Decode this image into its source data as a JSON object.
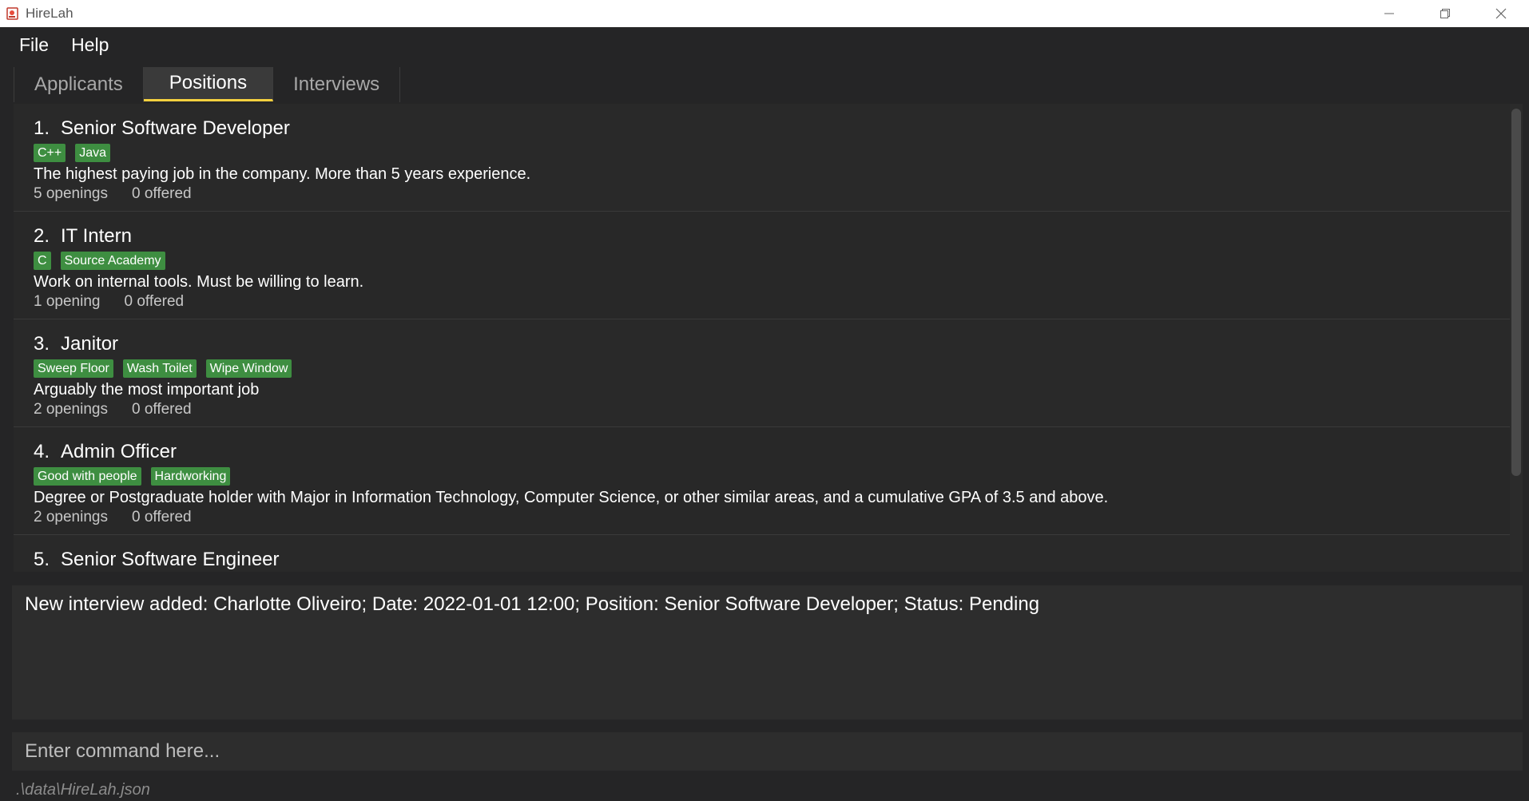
{
  "window": {
    "title": "HireLah"
  },
  "menu": {
    "file": "File",
    "help": "Help"
  },
  "tabs": [
    {
      "label": "Applicants"
    },
    {
      "label": "Positions"
    },
    {
      "label": "Interviews"
    }
  ],
  "positions": [
    {
      "index": "1.",
      "title": "Senior Software Developer",
      "tags": [
        "C++",
        "Java"
      ],
      "description": "The highest paying job in the company. More than 5 years experience.",
      "openings": "5 openings",
      "offered": "0 offered"
    },
    {
      "index": "2.",
      "title": "IT Intern",
      "tags": [
        "C",
        "Source Academy"
      ],
      "description": "Work on internal tools. Must be willing to learn.",
      "openings": "1 opening",
      "offered": "0 offered"
    },
    {
      "index": "3.",
      "title": "Janitor",
      "tags": [
        "Sweep Floor",
        "Wash Toilet",
        "Wipe Window"
      ],
      "description": "Arguably the most important job",
      "openings": "2 openings",
      "offered": "0 offered"
    },
    {
      "index": "4.",
      "title": "Admin Officer",
      "tags": [
        "Good with people",
        "Hardworking"
      ],
      "description": "Degree or Postgraduate holder with Major in Information Technology, Computer Science, or other similar areas, and a cumulative GPA of 3.5 and above.",
      "openings": "2 openings",
      "offered": "0 offered"
    },
    {
      "index": "5.",
      "title": "Senior Software Engineer"
    }
  ],
  "result": {
    "message": "New interview added: Charlotte Oliveiro; Date: 2022-01-01 12:00; Position: Senior Software Developer; Status: Pending"
  },
  "command": {
    "placeholder": "Enter command here..."
  },
  "status": {
    "path": ".\\data\\HireLah.json"
  },
  "colors": {
    "tag": "#3e8e41",
    "active_tab_underline": "#f4d03f",
    "background": "#252526"
  }
}
